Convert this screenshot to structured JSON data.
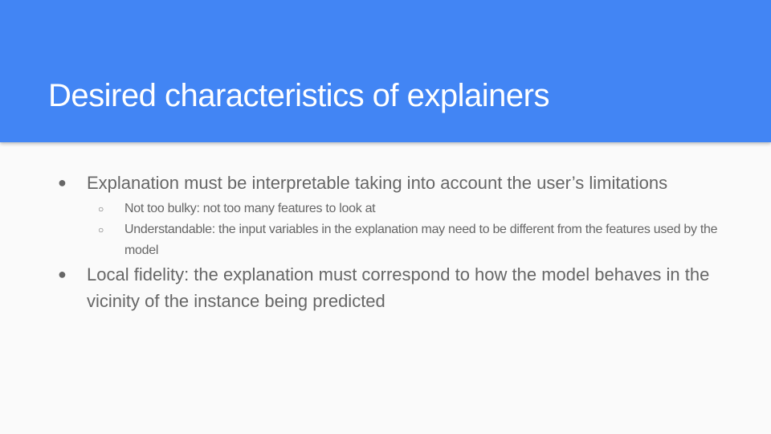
{
  "slide": {
    "title": "Desired characteristics of explainers",
    "header_color": "#4285f4",
    "bullets": [
      {
        "text": "Explanation must be interpretable taking into account the user’s limitations",
        "sub": [
          "Not too bulky: not too many features to look at",
          "Understandable: the input variables in the explanation may need to be different from the features used by the model"
        ]
      },
      {
        "text": "Local fidelity:  the explanation must correspond to how the model behaves in the vicinity of the instance being predicted"
      }
    ],
    "bullet_glyph": "●",
    "sub_bullet_glyph": "○"
  }
}
